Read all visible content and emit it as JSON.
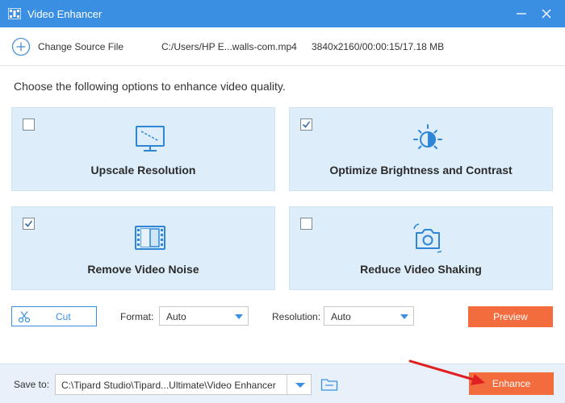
{
  "window": {
    "title": "Video Enhancer"
  },
  "source": {
    "change_label": "Change Source File",
    "file_path": "C:/Users/HP E...walls-com.mp4",
    "file_info": "3840x2160/00:00:15/17.18 MB"
  },
  "prompt": "Choose the following options to enhance video quality.",
  "options": [
    {
      "label": "Upscale Resolution",
      "checked": false,
      "icon": "monitor-icon"
    },
    {
      "label": "Optimize Brightness and Contrast",
      "checked": true,
      "icon": "brightness-icon"
    },
    {
      "label": "Remove Video Noise",
      "checked": true,
      "icon": "film-icon"
    },
    {
      "label": "Reduce Video Shaking",
      "checked": false,
      "icon": "camera-stabilize-icon"
    }
  ],
  "toolbar": {
    "cut_label": "Cut",
    "format_label": "Format:",
    "format_value": "Auto",
    "resolution_label": "Resolution:",
    "resolution_value": "Auto",
    "preview_label": "Preview"
  },
  "footer": {
    "save_label": "Save to:",
    "save_path": "C:\\Tipard Studio\\Tipard...Ultimate\\Video Enhancer",
    "enhance_label": "Enhance"
  },
  "colors": {
    "titlebar": "#3a8fe3",
    "card_bg": "#ddeefa",
    "accent": "#3a8fe3",
    "action": "#f36c3e",
    "annotation_arrow": "#e02020"
  }
}
